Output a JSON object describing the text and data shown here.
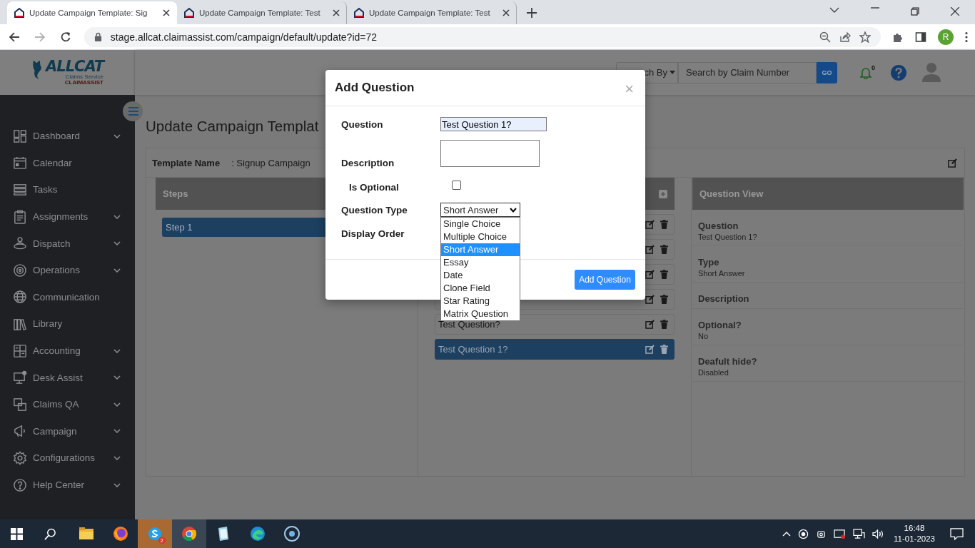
{
  "browser": {
    "tabs": [
      {
        "title": "Update Campaign Template: Sig",
        "selected": true
      },
      {
        "title": "Update Campaign Template: Test",
        "selected": false
      },
      {
        "title": "Update Campaign Template: Test",
        "selected": false
      }
    ],
    "url": "stage.allcat.claimassist.com/campaign/default/update?id=72",
    "profile_initial": "R"
  },
  "header": {
    "logo": "ALLCAT",
    "logo_tagline": "Claims Service",
    "logo_brand": "CLAIMASSIST",
    "search_by": "ch By",
    "search": {
      "placeholder": "Search by Claim Number"
    },
    "go": "GO",
    "notifications": "0"
  },
  "sidebar": {
    "items": [
      {
        "label": "Dashboard",
        "expandable": true
      },
      {
        "label": "Calendar",
        "expandable": false
      },
      {
        "label": "Tasks",
        "expandable": false
      },
      {
        "label": "Assignments",
        "expandable": true
      },
      {
        "label": "Dispatch",
        "expandable": true
      },
      {
        "label": "Operations",
        "expandable": true
      },
      {
        "label": "Communication",
        "expandable": false
      },
      {
        "label": "Library",
        "expandable": false
      },
      {
        "label": "Accounting",
        "expandable": true
      },
      {
        "label": "Desk Assist",
        "expandable": true
      },
      {
        "label": "Claims QA",
        "expandable": true
      },
      {
        "label": "Campaign",
        "expandable": true
      },
      {
        "label": "Configurations",
        "expandable": true
      },
      {
        "label": "Help Center",
        "expandable": true
      }
    ]
  },
  "page": {
    "title": "Update Campaign Templat",
    "template_label": "Template Name",
    "template_value": ": Signup Campaign",
    "steps": {
      "heading": "Steps",
      "items": [
        {
          "label": "Step 1",
          "selected": true
        }
      ]
    },
    "questions": {
      "items": [
        {
          "selected": false
        },
        {
          "selected": false
        },
        {
          "selected": false
        },
        {
          "selected": false
        },
        {
          "text": "Test Question?",
          "selected": false
        },
        {
          "text": "Test Question 1?",
          "selected": true
        }
      ]
    },
    "question_view": {
      "heading": "Question View",
      "fields": [
        {
          "label": "Question",
          "value": "Test Question 1?"
        },
        {
          "label": "Type",
          "value": "Short Answer"
        },
        {
          "label": "Description"
        },
        {
          "label": "Optional?",
          "value": "No"
        },
        {
          "label": "Deafult hide?",
          "value": "Disabled"
        }
      ]
    }
  },
  "modal": {
    "title": "Add Question",
    "close": "×",
    "question_label": "Question",
    "question_value": "Test Question 1?",
    "description_label": "Description",
    "optional_label": "Is Optional",
    "optional_checked": false,
    "type_label": "Question Type",
    "type_value": "Short Answer",
    "order_label": "Display Order",
    "type_options": [
      {
        "label": "Single Choice",
        "selected": false
      },
      {
        "label": "Multiple Choice",
        "selected": false
      },
      {
        "label": "Short Answer",
        "selected": true
      },
      {
        "label": "Essay",
        "selected": false
      },
      {
        "label": "Date",
        "selected": false
      },
      {
        "label": "Clone Field",
        "selected": false
      },
      {
        "label": "Star Rating",
        "selected": false
      },
      {
        "label": "Matrix Question",
        "selected": false
      }
    ],
    "submit": "Add Question"
  },
  "taskbar": {
    "apps": [
      {
        "selected": false
      },
      {
        "selected": false
      },
      {
        "selected": false,
        "badge": "2"
      },
      {
        "selected": true
      },
      {
        "selected": false
      },
      {
        "selected": false
      },
      {
        "selected": false
      }
    ],
    "time": "16:48",
    "date": "11-01-2023"
  }
}
